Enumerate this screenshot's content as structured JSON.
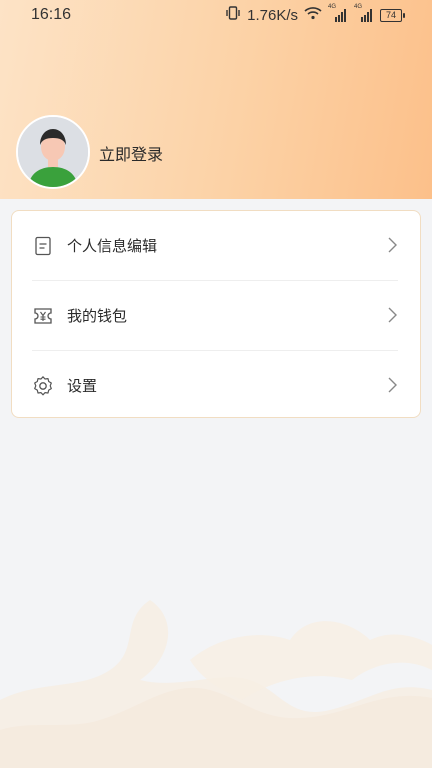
{
  "status_bar": {
    "time": "16:16",
    "speed": "1.76K/s",
    "signal1_label": "4G",
    "signal2_label": "4G",
    "battery": "74"
  },
  "profile": {
    "login_label": "立即登录"
  },
  "menu": {
    "items": [
      {
        "label": "个人信息编辑",
        "icon": "document-icon"
      },
      {
        "label": "我的钱包",
        "icon": "wallet-icon"
      },
      {
        "label": "设置",
        "icon": "gear-icon"
      }
    ]
  },
  "colors": {
    "header_start": "#fde3c6",
    "header_end": "#fcc08a",
    "background": "#f3f4f6",
    "card_border": "#f1ddc2"
  }
}
